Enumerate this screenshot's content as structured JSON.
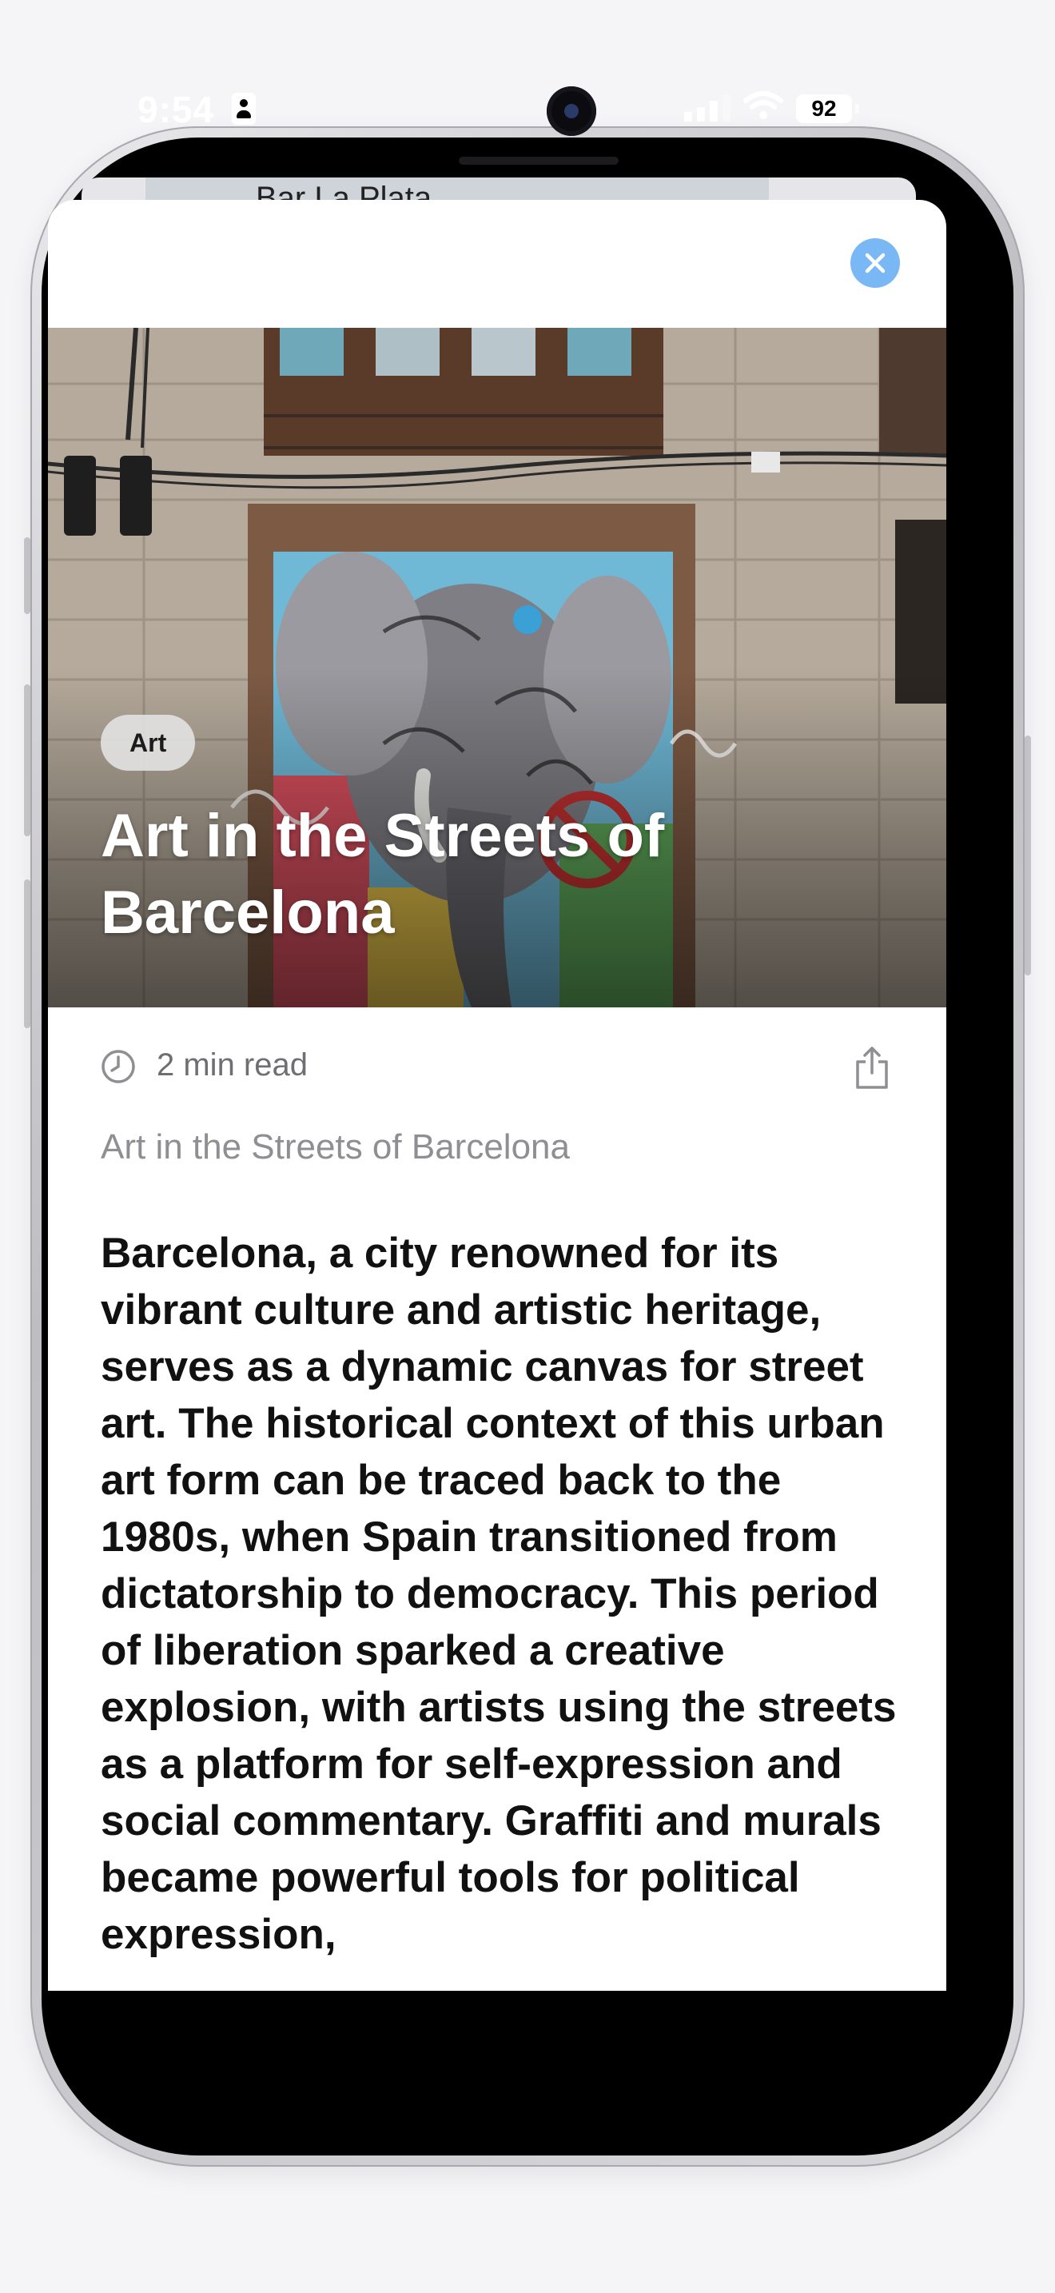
{
  "status_bar": {
    "time": "9:54",
    "battery": "92"
  },
  "background_card": {
    "label": "Bar La Plata"
  },
  "article": {
    "category": "Art",
    "hero_title": "Art in the Streets of Barcelona",
    "read_time": "2 min read",
    "subtitle": "Art in the Streets of Barcelona",
    "body": "Barcelona, a city renowned for its vibrant culture and artistic heritage, serves as a dynamic canvas for street art. The historical context of this urban art form can be traced back to the 1980s, when Spain transitioned from dictatorship to democracy. This period of liberation sparked a creative explosion, with artists using the streets as a platform for self-expression and social commentary. Graffiti and murals became powerful tools for political expression,"
  },
  "icons": {
    "close": "close-icon",
    "clock": "clock-icon",
    "share": "share-icon"
  },
  "colors": {
    "close_button": "#7ab8f5",
    "secondary_text": "#8e8e93"
  }
}
